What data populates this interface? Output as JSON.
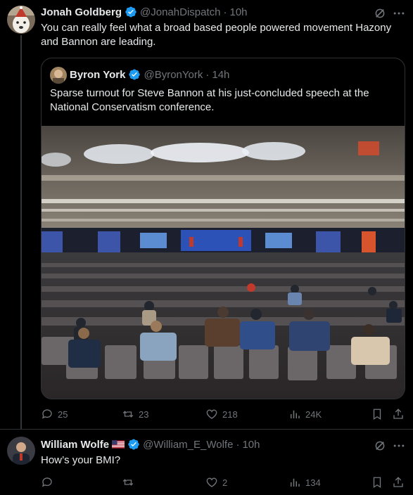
{
  "post1": {
    "author_name": "Jonah Goldberg",
    "handle": "@JonahDispatch",
    "separator": "·",
    "time": "10h",
    "text": "You can really feel what a broad based people powered movement Hazony and Bannon are leading.",
    "quote": {
      "author_name": "Byron York",
      "handle": "@ByronYork",
      "separator": "·",
      "time": "14h",
      "text": "Sparse turnout for Steve Bannon at his just-concluded speech at the National Conservatism conference."
    },
    "actions": {
      "replies": "25",
      "reposts": "23",
      "likes": "218",
      "views": "24K"
    }
  },
  "post2": {
    "author_name": "William Wolfe",
    "handle": "@William_E_Wolfe",
    "separator": "·",
    "time": "10h",
    "text": "How’s your BMI?",
    "actions": {
      "replies": "",
      "reposts": "",
      "likes": "2",
      "views": "134"
    }
  },
  "colors": {
    "verified": "#1d9bf0",
    "muted": "#71767b",
    "text": "#e7e9ea",
    "border": "#2f3336",
    "background": "#000000"
  },
  "icons": [
    "verified-badge-icon",
    "grok-icon",
    "more-icon",
    "reply-icon",
    "repost-icon",
    "like-icon",
    "views-icon",
    "bookmark-icon",
    "share-icon",
    "us-flag-icon"
  ]
}
